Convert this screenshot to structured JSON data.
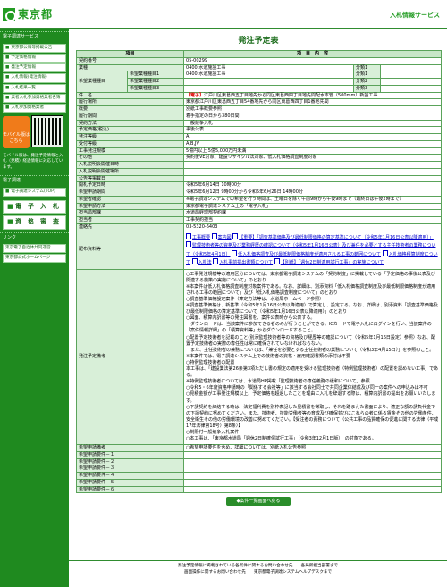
{
  "header": {
    "logo": "東京都",
    "service": "入札情報サービス"
  },
  "sidebar": {
    "section1": "電子調達サービス",
    "menu1": [
      "東京都公報等掲載公告",
      "予定価格情報",
      "発注予定情報",
      "入札情報(発注情報)",
      "入札結果一覧",
      "業者入札参加資格業者名簿",
      "入札参加資格業者"
    ],
    "mobile_btn": "モバイル版はこちら",
    "mobile_note": "モバイル版は、発注予定情報と入札（見積）経過情報に対応しています。",
    "section2": "電子調達",
    "menu2": [
      "電子調達システム(TOP)"
    ],
    "big": [
      "電　子　入　札",
      "資　格　審　査"
    ],
    "section3": "リンク",
    "links": [
      "東京電子自治体共同運営",
      "東京都公式ホームページ"
    ]
  },
  "main": {
    "title": "発注予定表",
    "col_item": "項目",
    "col_content": "項　目　内　容",
    "rows": {
      "keiyaku_no": {
        "k": "契約番号",
        "v": "05-00299"
      },
      "gyomu": {
        "k": "業種",
        "v": "0400 水道施設工事",
        "bunrui": "分類1"
      },
      "kibou": {
        "k": "希望業種種目",
        "items": [
          {
            "k": "希望業種種目1",
            "v": "0400 水道施設工事",
            "b": "分類1"
          },
          {
            "k": "希望業種種目2",
            "v": "",
            "b": "分類2"
          },
          {
            "k": "希望業種種目3",
            "v": "",
            "b": "分類3"
          }
        ]
      },
      "kenmei": {
        "k": "件　名",
        "tag": "【電子】",
        "v": "江戸川区東葛西五丁目地先から同区東葛西四丁目地先間配水本管（500mm）新設工事"
      },
      "basho": {
        "k": "履行場所",
        "v": "東京都江戸川区東葛西五丁目54番地先から同区東葛西四丁目1番地先間"
      },
      "gaiyo": {
        "k": "概要",
        "v": "別紙工事概要参照"
      },
      "kikan": {
        "k": "履行期間",
        "v": "着手指定の日から380日間"
      },
      "hoho": {
        "k": "契約方法",
        "v": "一般競争入札"
      },
      "kakaku": {
        "k": "予定価格(税込)",
        "v": "事後公表"
      },
      "tokyu": {
        "k": "発注等級",
        "v": "A"
      },
      "ukemochi": {
        "k": "受付等級",
        "v": "A,B,JV"
      },
      "gaku": {
        "k": "工事発注規模",
        "v": "5億円以上 5億5,000万円未満"
      },
      "sonota": {
        "k": "その他",
        "v": "契約後VE対象、建設リサイクル法対象、低入札価格調査制度対象"
      },
      "kaisai": {
        "k": "入札説明会開催日時",
        "v": ""
      },
      "basho2": {
        "k": "入札説明会開催場所",
        "v": ""
      },
      "koukoku": {
        "k": "公告等掲載日",
        "v": ""
      },
      "kaisatsu": {
        "k": "開札予定日時",
        "v": "令和5年6月14日 10時00分"
      },
      "uketsuke": {
        "k": "希望申請期間",
        "v": "令和5年6月12日 9時00分から令和5年6月26日 14時00分"
      },
      "ukesho": {
        "k": "希望者確認",
        "v": "※電子調達システムでの希望を行う時間は、土曜日を除く午前9時から午後9時まで（最終日は午後2時まで）"
      },
      "houhou": {
        "k": "希望申請方法",
        "v": "東京都電子調達システム上の「電子入札」"
      },
      "tanto": {
        "k": "担当局部課",
        "v": "水道局経理部契約課"
      },
      "tanto2": {
        "k": "担当者",
        "v": "工事契約担当"
      },
      "renraku": {
        "k": "連絡先",
        "v": "03-5320-6403"
      },
      "shiryo": {
        "k": "配布資料等",
        "links": [
          "工事概要",
          "案内図",
          "【重要】「調査基準価格及び最低制限価格の算定基準について（令和5年1月16日公表以降適用）」",
          "監理技術者等の資格及び業務経歴の確認について（令和5年1月16日公表）及び兼任を必要とする主任技術者の業務について（令和5年4月1日）",
          "低入札価格調査及び最低制限価格制度が適用される工事の範囲について",
          "入札価格積算制度について",
          "入札法",
          "入札事前提出書類について",
          "【別紙】「週休2日制適用試行工事」の実施について"
        ]
      },
      "biko": {
        "k": "発注予定備考",
        "lines": [
          "○工事発注規模等の適用区分については、東京都電子調達システムの「契約制度」に掲載している「予定価格の事後公表及び関連する施策の実施について」のとおり",
          "※本案件は低入札価格調査制度対象案件である。なお、詳細は、別添資料「低入札価格調査制度及び最低制限価格制度が適用される工事の範囲について」及び「低入札価格調査制度について」のとおり",
          "○調査基準価格設定案件（算定方法等は、水道局ホームページ参照）",
          "※調査基準価格は、新基準（令和5年1月16日公表以降適用）で算定し、設定する。なお、詳細は、別添資料「調査基準価格及び最低制限価格の算定基準について（令和5年1月16日公表以降適用）」のとおり",
          "○図面、積算内訳書等の発注図書を、案件公表時から公表する。",
          "　ダウンロードは、当該案件に参加できる者のみが行うことができる。ICカードで電子入札にログインを行い、当該案件の「案件情報詳細」の「積算資料等」からダウンロードすること。",
          "○配置予定技術者を記載のこと(別添監理技術者等の資格及び経歴等の確認について（令和5年1月16日設定）参照）なお、配置予定技術者の実際の専任性は常に確保されていなければならない。",
          "　また、主任技術者の兼務については、「兼任を必要とする主任技術者の業務について（令和3年4月15日）」を参照のこと。",
          "※本案件では、電子調達システム上での技術者の資格・雇用確認書類の添付は不要",
          "○特例監理技術者の配置",
          "本工事は、「建設業法第26条第3項ただし書の規定の適用を受ける監理技術者（特例監理技術者）の配置を認めない工事」である。",
          "※特例監理技術者については、水道局HP掲載「監理技術者の専任義務の緩和について」参照",
          "○令和5・6年度資格申請時の「関係する会社等」に該当する会社同士で共同企業体結成及び同一の案件への申込みは不可",
          "○見積金額が工事発注規模以上、予定価格を超過したことを理由に入札を辞退する際は、積算内訳書の提出をお願いいたします。",
          "○下請契約を締結する時は、法定福利費を別枠表記した見積書を徴取し、それを踏まえた書面により、適正な額の請負代金での下請契約に努めてください。また、技術者、技能労働者等の育成及び確保並びにこれらの者に係る賃金その他の労働条件、安全衛生その他の労働環境の改善に努めてください。【受注者の責務について（公共工事の品質確保の促進に関する法律（平成17年法律第18号）第8条）】",
          "○制限付一般競争入札案件",
          "○本工事は、「東京都水道局「週休2日制確保試行工事」（令和3年12月1日版）」の対象である。"
        ]
      },
      "kibou_biko": {
        "k": "希望申請備考",
        "v": "○希望申請要件を含め、詳細については、別紙入札公告参照"
      },
      "kibou_yoken": [
        {
          "k": "希望申請要件－１",
          "v": ""
        },
        {
          "k": "希望申請要件－２",
          "v": ""
        },
        {
          "k": "希望申請要件－３",
          "v": ""
        },
        {
          "k": "希望申請要件－４",
          "v": ""
        },
        {
          "k": "希望申請要件－５",
          "v": ""
        },
        {
          "k": "希望申請要件－６",
          "v": ""
        }
      ]
    },
    "back": "◆案件一覧画面へ戻る"
  },
  "footer": {
    "line1": "発注予定情報に掲載されている各案件に関するお問い合わせ先　　各局所担当部署まで",
    "line2": "画面操作に関するお問い合わせ先　　東京都電子調達システムヘルプデスクまで"
  }
}
